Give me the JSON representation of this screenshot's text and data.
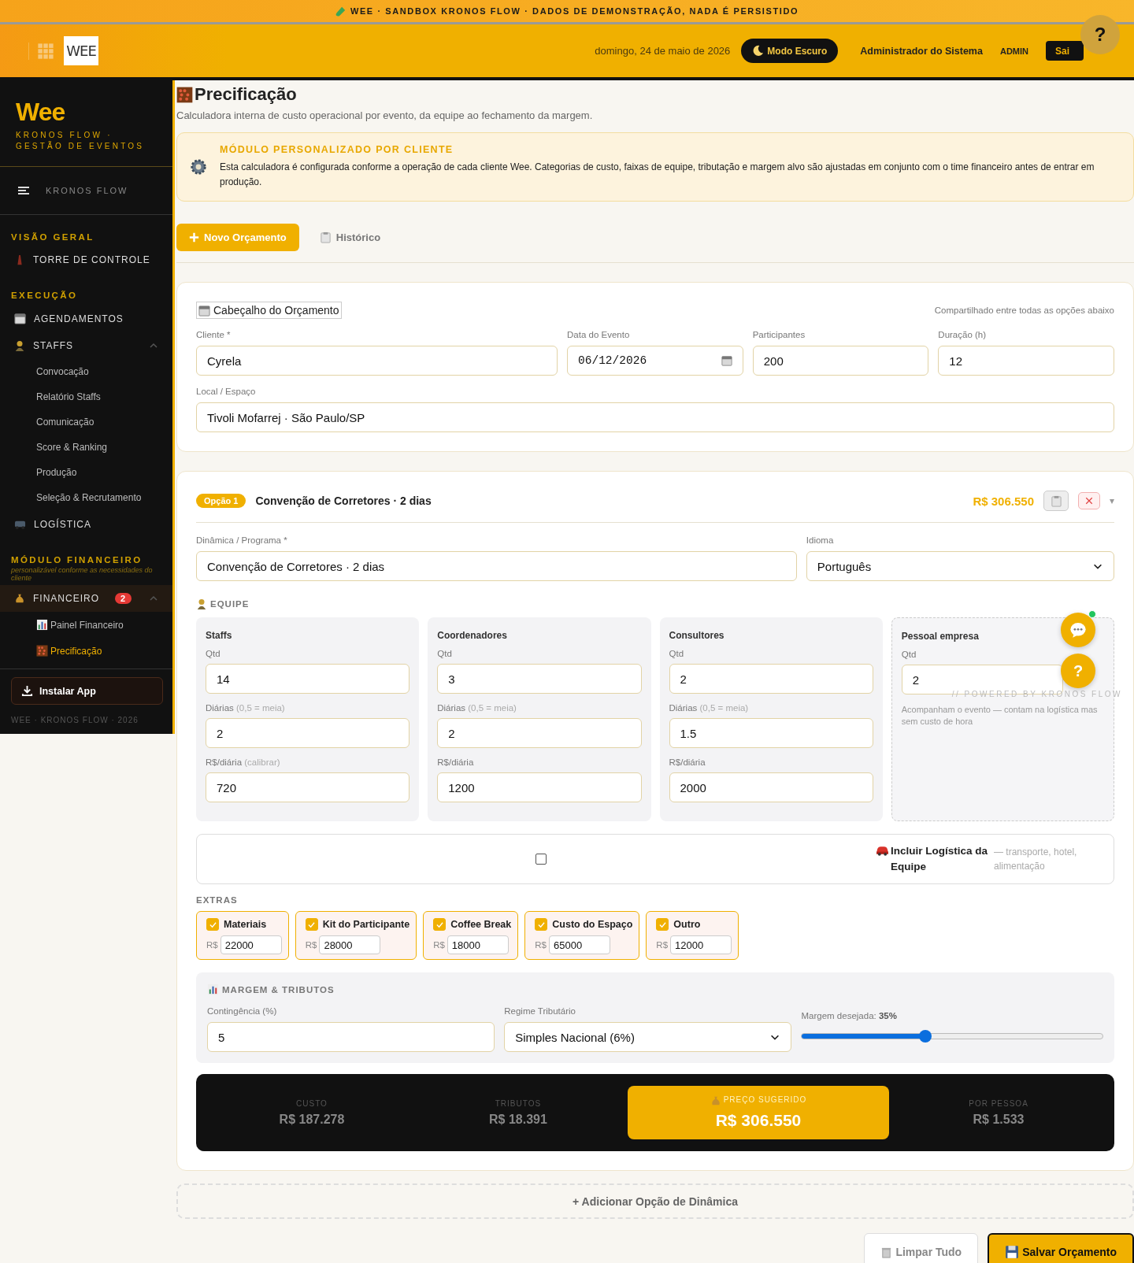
{
  "banner": {
    "text": "WEE · SANDBOX KRONOS FLOW · DADOS DE DEMONSTRAÇÃO, NADA É PERSISTIDO"
  },
  "header": {
    "logo": "WEE",
    "date": "domingo, 24 de maio de 2026",
    "dark_mode_button": "Modo Escuro",
    "user_name": "Administrador do Sistema",
    "role": "ADMIN",
    "logout_button": "Sai",
    "help_button": "?"
  },
  "sidebar": {
    "brand": "Wee",
    "tagline": "KRONOS FLOW · GESTÃO DE EVENTOS",
    "menu_label": "KRONOS FLOW",
    "sections": [
      {
        "title": "VISÃO GERAL",
        "items": [
          {
            "label": "TORRE DE CONTROLE",
            "selected": false
          }
        ]
      },
      {
        "title": "EXECUÇÃO",
        "items": [
          {
            "label": "AGENDAMENTOS",
            "selected": false
          },
          {
            "label": "STAFFS",
            "selected": false,
            "expanded": true,
            "children": [
              {
                "label": "Convocação",
                "selected": false
              },
              {
                "label": "Relatório Staffs",
                "selected": false
              },
              {
                "label": "Comunicação",
                "selected": false
              },
              {
                "label": "Score & Ranking",
                "selected": false
              },
              {
                "label": "Produção",
                "selected": false
              },
              {
                "label": "Seleção & Recrutamento",
                "selected": false
              }
            ]
          },
          {
            "label": "LOGÍSTICA",
            "selected": false
          }
        ]
      },
      {
        "title": "MÓDULO FINANCEIRO",
        "subtitle": "personalizável conforme as necessidades do cliente",
        "items": [
          {
            "label": "FINANCEIRO",
            "selected": true,
            "badge": "2",
            "expanded": true,
            "children": [
              {
                "label": "Painel Financeiro",
                "selected": false
              },
              {
                "label": "Precificação",
                "selected": true
              }
            ]
          }
        ]
      }
    ],
    "install_button": "Instalar App",
    "footer": "WEE · KRONOS FLOW · 2026"
  },
  "page": {
    "title": "Precificação",
    "subtitle": "Calculadora interna de custo operacional por evento, da equipe ao fechamento da margem."
  },
  "notice": {
    "title": "MÓDULO PERSONALIZADO POR CLIENTE",
    "text": "Esta calculadora é configurada conforme a operação de cada cliente Wee. Categorias de custo, faixas de equipe, tributação e margem alvo são ajustadas em conjunto com o time financeiro antes de entrar em produção."
  },
  "tabs": [
    {
      "label": "Novo Orçamento",
      "selected": true
    },
    {
      "label": "Histórico",
      "selected": false
    }
  ],
  "header_card": {
    "title": "Cabeçalho do Orçamento",
    "note": "Compartilhado entre todas as opções abaixo",
    "fields": [
      {
        "label": "Cliente *",
        "value": "Cyrela",
        "kind": "text"
      },
      {
        "label": "Data do Evento",
        "value": "06/12/2026",
        "kind": "date"
      },
      {
        "label": "Participantes",
        "value": "200",
        "kind": "text"
      },
      {
        "label": "Duração (h)",
        "value": "12",
        "kind": "text"
      },
      {
        "label": "Local / Espaço",
        "value": "Tivoli Mofarrej · São Paulo/SP",
        "kind": "text"
      }
    ]
  },
  "option": {
    "badge": "Opção 1",
    "title": "Convenção de Corretores · 2 dias",
    "total": "R$ 306.550",
    "toggle": "▾",
    "program": {
      "label": "Dinâmica / Programa *",
      "value": "Convenção de Corretores · 2 dias"
    },
    "language": {
      "label": "Idioma",
      "value": "Português"
    },
    "team": {
      "title": "EQUIPE",
      "roles": [
        {
          "name": "Staffs",
          "kind": "paid",
          "fields": [
            {
              "label": "Qtd",
              "value": "14"
            },
            {
              "label": "Diárias",
              "hint": "(0,5 = meia)",
              "value": "2"
            },
            {
              "label": "R$/diária",
              "hint": "(calibrar)",
              "value": "720"
            }
          ]
        },
        {
          "name": "Coordenadores",
          "kind": "paid",
          "fields": [
            {
              "label": "Qtd",
              "value": "3"
            },
            {
              "label": "Diárias",
              "hint": "(0,5 = meia)",
              "value": "2"
            },
            {
              "label": "R$/diária",
              "value": "1200"
            }
          ]
        },
        {
          "name": "Consultores",
          "kind": "paid",
          "fields": [
            {
              "label": "Qtd",
              "value": "2"
            },
            {
              "label": "Diárias",
              "hint": "(0,5 = meia)",
              "value": "1.5"
            },
            {
              "label": "R$/diária",
              "value": "2000"
            }
          ]
        },
        {
          "name": "Pessoal empresa",
          "kind": "internal",
          "fields": [
            {
              "label": "Qtd",
              "value": "2"
            }
          ],
          "note": "Acompanham o evento — contam na logística mas sem custo de hora"
        }
      ]
    },
    "powered_by": "// POWERED BY KRONOS FLOW",
    "logistics": {
      "checked": false,
      "label": "Incluir Logística da Equipe",
      "hint": "— transporte, hotel, alimentação"
    },
    "extras": {
      "title": "EXTRAS",
      "items": [
        {
          "label": "Materiais",
          "checked": true,
          "currency": "R$",
          "value": "22000"
        },
        {
          "label": "Kit do Participante",
          "checked": true,
          "currency": "R$",
          "value": "28000"
        },
        {
          "label": "Coffee Break",
          "checked": true,
          "currency": "R$",
          "value": "18000"
        },
        {
          "label": "Custo do Espaço",
          "checked": true,
          "currency": "R$",
          "value": "65000"
        },
        {
          "label": "Outro",
          "checked": true,
          "currency": "R$",
          "value": "12000"
        }
      ]
    },
    "margin": {
      "title": "MARGEM & TRIBUTOS",
      "contingency": {
        "label": "Contingência (%)",
        "value": "5"
      },
      "regime": {
        "label": "Regime Tributário",
        "value": "Simples Nacional (6%)"
      },
      "slider": {
        "label": "Margem desejada:",
        "reading": "35%",
        "level": 0.41
      }
    },
    "summary": [
      {
        "label": "CUSTO",
        "value": "R$ 187.278",
        "highlight": false
      },
      {
        "label": "TRIBUTOS",
        "value": "R$ 18.391",
        "highlight": false
      },
      {
        "label": "PREÇO SUGERIDO",
        "value": "R$ 306.550",
        "highlight": true
      },
      {
        "label": "POR PESSOA",
        "value": "R$ 1.533",
        "highlight": false
      }
    ]
  },
  "add_option_button": "+ Adicionar Opção de Dinâmica",
  "actions": [
    {
      "label": "Limpar Tudo",
      "kind": "secondary"
    },
    {
      "label": "Salvar Orçamento",
      "kind": "primary"
    }
  ],
  "floating": {
    "chat_notification": true,
    "help_button": "?"
  }
}
